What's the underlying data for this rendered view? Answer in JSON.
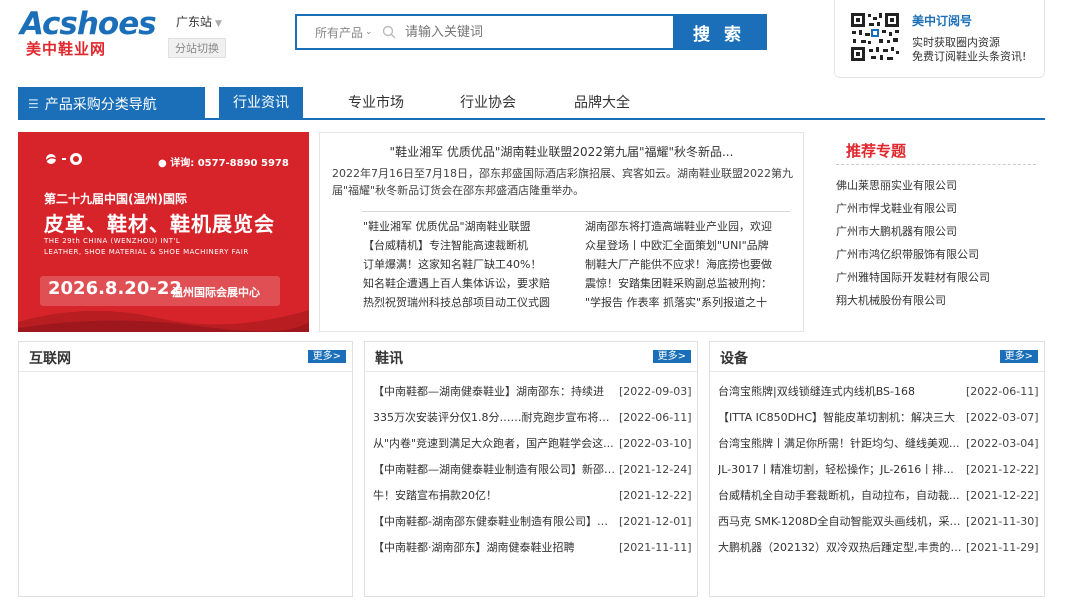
{
  "header": {
    "logo_en": "Acshoes",
    "logo_cn": "美中鞋业网",
    "station": "广东站",
    "switch_label": "分站切换",
    "search": {
      "category": "所有产品",
      "placeholder": "请输入关键词",
      "button": "搜 索"
    },
    "subscribe": {
      "title": "美中订阅号",
      "line1": "实时获取圈内资源",
      "line2": "免费订阅鞋业头条资讯!"
    }
  },
  "nav": {
    "category": "产品采购分类导航",
    "items": [
      "行业资讯",
      "专业市场",
      "行业协会",
      "品牌大全"
    ]
  },
  "banner": {
    "phone": "详询: 0577-8890 5978",
    "subtitle": "第二十九届中国(温州)国际",
    "title": "皮革、鞋材、鞋机展览会",
    "en1": "THE 29th CHINA (WENZHOU) INT'L",
    "en2": "LEATHER, SHOE MATERIAL & SHOE MACHINERY FAIR",
    "date": "2026.8.20-22",
    "venue": "温州国际会展中心"
  },
  "headline": {
    "title": "\"鞋业湘军 优质优品\"湖南鞋业联盟2022第九届\"福耀\"秋冬新品...",
    "summary": "2022年7月16日至7月18日，邵东邦盛国际酒店彩旗招展、宾客如云。湖南鞋业联盟2022第九届\"福耀\"秋冬新品订货会在邵东邦盛酒店隆重举办。",
    "left": [
      "\"鞋业湘军 优质优品\"湖南鞋业联盟",
      "【台威精机】专注智能高速裁断机",
      "订单爆满！这家知名鞋厂缺工40%！",
      "知名鞋企遭遇上百人集体诉讼，要求赔",
      "热烈祝贺瑞州科技总部项目动工仪式圆"
    ],
    "right": [
      "湖南邵东将打造高端鞋业产业园，欢迎",
      "众星登场丨中欧汇全面策划\"UNI\"品牌",
      "制鞋大厂产能供不应求！海底捞也要做",
      "震惊！安踏集团鞋采购副总监被刑拘：",
      "\"学报告 作表率 抓落实\"系列报道之十"
    ]
  },
  "recommend": {
    "title": "推荐专题",
    "items": [
      "佛山莱思丽实业有限公司",
      "广州市悍戈鞋业有限公司",
      "广州市大鹏机器有限公司",
      "广州市鸿亿织带服饰有限公司",
      "广州雅特国际开发鞋材有限公司",
      "翔大机械股份有限公司"
    ]
  },
  "panels": {
    "internet": {
      "title": "互联网",
      "more": "更多>"
    },
    "shoes": {
      "title": "鞋讯",
      "more": "更多>",
      "rows": [
        {
          "t": "【中南鞋都—湖南健泰鞋业】湖南邵东：持续进",
          "d": "[2022-09-03]"
        },
        {
          "t": "335万次安装评分仅1.8分……耐克跑步宣布将停...",
          "d": "[2022-06-11]"
        },
        {
          "t": "从\"内卷\"竞速到满足大众跑者，国产跑鞋学会这...",
          "d": "[2022-03-10]"
        },
        {
          "t": "【中南鞋都—湖南健泰鞋业制造有限公司】新邵县...",
          "d": "[2021-12-24]"
        },
        {
          "t": "牛！安踏宣布捐款20亿！",
          "d": "[2021-12-22]"
        },
        {
          "t": "【中南鞋都-湖南邵东健泰鞋业制造有限公司】邵...",
          "d": "[2021-12-01]"
        },
        {
          "t": "【中南鞋都·湖南邵东】湖南健泰鞋业招聘",
          "d": "[2021-11-11]"
        }
      ]
    },
    "equip": {
      "title": "设备",
      "more": "更多>",
      "rows": [
        {
          "t": "台湾宝熊牌|双线锁缝连式内线机BS-168",
          "d": "[2022-06-11]"
        },
        {
          "t": "【ITTA IC850DHC】智能皮革切割机：解决三大",
          "d": "[2022-03-07]"
        },
        {
          "t": "台湾宝熊牌丨满足你所需！针距均匀、缝线美观...",
          "d": "[2022-03-04]"
        },
        {
          "t": "JL-3017丨精准切割，轻松操作；JL-2616丨排...",
          "d": "[2021-12-22]"
        },
        {
          "t": "台威精机全自动手套裁断机，自动拉布，自动裁...",
          "d": "[2021-12-22]"
        },
        {
          "t": "西马克 SMK-1208D全自动智能双头画线机，采用...",
          "d": "[2021-11-30]"
        },
        {
          "t": "大鹏机器（202132）双冷双热后踵定型,丰贵的追...",
          "d": "[2021-11-29]"
        }
      ]
    }
  }
}
